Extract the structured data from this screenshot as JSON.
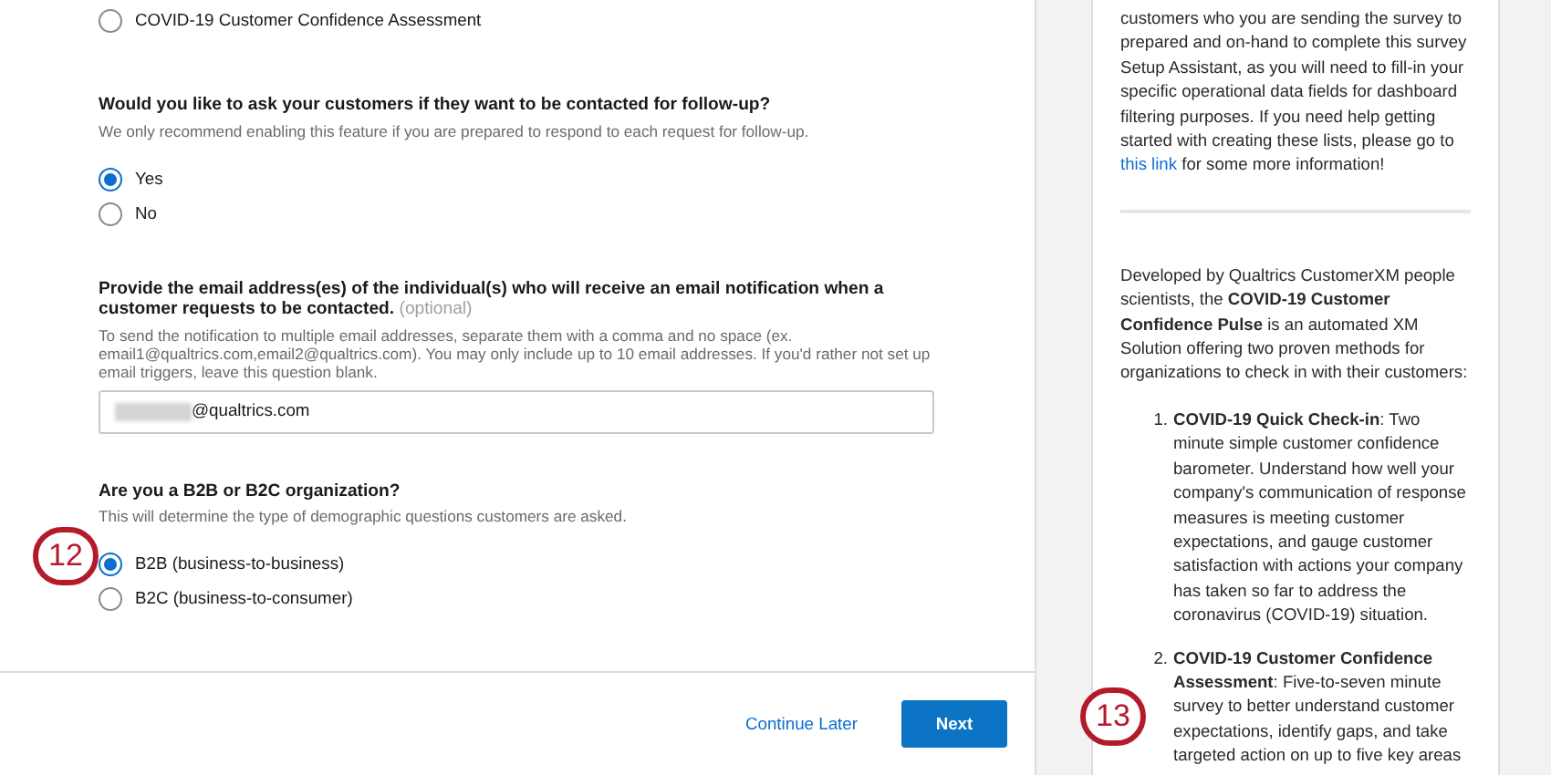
{
  "survey_choice": {
    "label": "COVID-19 Customer Confidence Assessment",
    "selected": false
  },
  "questions": [
    {
      "kind": "radio",
      "title": "Would you like to ask your customers if they want to be contacted for follow-up?",
      "help": "We only recommend enabling this feature if you are prepared to respond to each request for follow-up.",
      "options": [
        {
          "label": "Yes",
          "selected": true
        },
        {
          "label": "No",
          "selected": false
        }
      ]
    },
    {
      "kind": "text",
      "title": "Provide the email address(es) of the individual(s) who will receive an email notification when a customer requests to be contacted.",
      "optional": "(optional)",
      "help": "To send the notification to multiple email addresses, separate them with a comma and no space (ex. email1@qualtrics.com,email2@qualtrics.com). You may only include up to 10 email addresses. If you'd rather not set up email triggers, leave this question blank.",
      "value": "@qualtrics.com",
      "redacted": true
    },
    {
      "kind": "radio",
      "title": "Are you a B2B or B2C organization?",
      "help": "This will determine the type of demographic questions customers are asked.",
      "callout": "12",
      "options": [
        {
          "label": "B2B (business-to-business)",
          "selected": true
        },
        {
          "label": "B2C (business-to-consumer)",
          "selected": false
        }
      ]
    }
  ],
  "footer": {
    "continue_later": "Continue Later",
    "next": "Next",
    "next_callout": "13"
  },
  "sidebar": {
    "intro": {
      "before": "customers who you are sending the survey to prepared and on-hand to complete this survey Setup Assistant, as you will need to fill-in your specific operational data fields for dashboard filtering purposes. If you need help getting started with creating these lists, please go to",
      "link": "this link",
      "after": "for some more information!"
    },
    "description": "Developed by Qualtrics CustomerXM people scientists, the **COVID-19 Customer Confidence Pulse** is an automated XM Solution offering two proven methods for organizations to check in with their customers:",
    "methods": [
      {
        "number": "1.",
        "text": "**COVID-19 Quick Check-in**: Two minute simple customer confidence barometer. Understand how well your company's communication of response measures is meeting customer expectations, and gauge customer satisfaction with actions your company has taken so far to address the coronavirus (COVID-19) situation."
      },
      {
        "number": "2.",
        "text": "**COVID-19 Customer Confidence Assessment**: Five-to-seven minute survey to better understand customer expectations, identify gaps, and take targeted action on up to five key areas"
      }
    ]
  }
}
